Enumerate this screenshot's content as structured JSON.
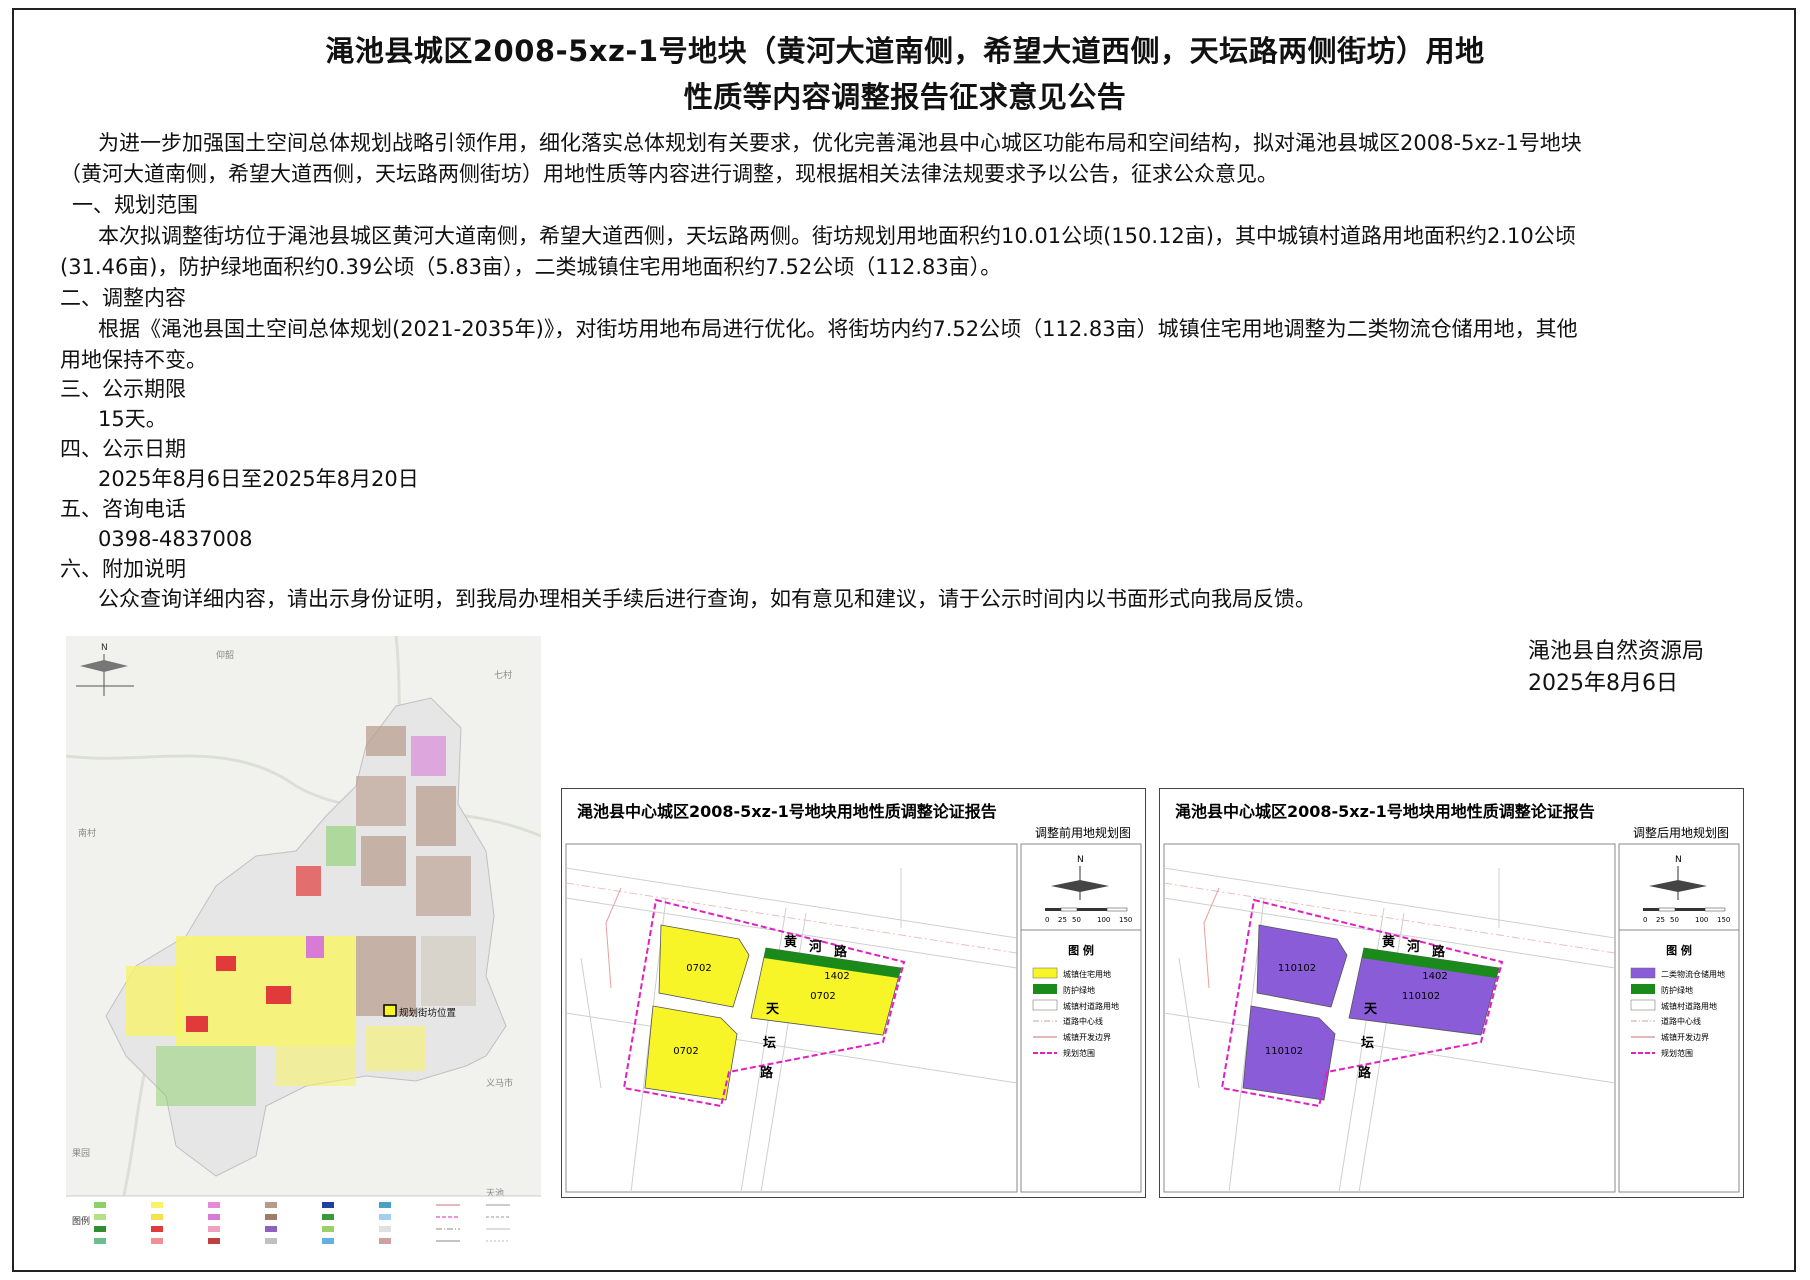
{
  "notice": {
    "title_line1": "渑池县城区2008-5xz-1号地块（黄河大道南侧，希望大道西侧，天坛路两侧街坊）用地",
    "title_line2": "性质等内容调整报告征求意见公告",
    "intro_line1": "为进一步加强国土空间总体规划战略引领作用，细化落实总体规划有关要求，优化完善渑池县中心城区功能布局和空间结构，拟对渑池县城区2008-5xz-1号地块",
    "intro_line2": "（黄河大道南侧，希望大道西侧，天坛路两侧街坊）用地性质等内容进行调整，现根据相关法律法规要求予以公告，征求公众意见。",
    "sections": [
      {
        "heading": "一、规划范围",
        "lines": [
          "本次拟调整街坊位于渑池县城区黄河大道南侧，希望大道西侧，天坛路两侧。街坊规划用地面积约10.01公顷(150.12亩)，其中城镇村道路用地面积约2.10公顷",
          "(31.46亩)，防护绿地面积约0.39公顷（5.83亩），二类城镇住宅用地面积约7.52公顷（112.83亩）。"
        ]
      },
      {
        "heading": "二、调整内容",
        "lines": [
          "根据《渑池县国土空间总体规划(2021-2035年)》，对街坊用地布局进行优化。将街坊内约7.52公顷（112.83亩）城镇住宅用地调整为二类物流仓储用地，其他",
          "用地保持不变。"
        ]
      },
      {
        "heading": "三、公示期限",
        "lines": [
          "15天。"
        ]
      },
      {
        "heading": "四、公示日期",
        "lines": [
          "2025年8月6日至2025年8月20日"
        ]
      },
      {
        "heading": "五、咨询电话",
        "lines": [
          "0398-4837008"
        ]
      },
      {
        "heading": "六、附加说明",
        "lines": [
          "公众查询详细内容，请出示身份证明，到我局办理相关手续后进行查询，如有意见和建议，请于公示时间内以书面形式向我局反馈。"
        ]
      }
    ],
    "signature": {
      "org": "渑池县自然资源局",
      "date": "2025年8月6日"
    }
  },
  "overview_map": {
    "north": "N",
    "site_label": "规划街坊位置",
    "legend_title": "图例",
    "town_labels": [
      "仰韶",
      "七村",
      "南村",
      "义马市",
      "果园",
      "天池"
    ],
    "colors": {
      "residential": "#f7f36a",
      "commercial": "#e03a3a",
      "industrial": "#b89a8a",
      "green": "#8bd06a",
      "public": "#d77bd6",
      "base": "#eeeeee"
    }
  },
  "maps": [
    {
      "title": "渑池县中心城区2008-5xz-1号地块用地性质调整论证报告",
      "subtitle": "调整前用地规划图",
      "parcel_codes": [
        "0702",
        "0702",
        "0702"
      ],
      "parcel_color": "#f7f527",
      "road_code": "1402",
      "road_huanghe": [
        "黄",
        "河",
        "路"
      ],
      "road_tiantan": [
        "天",
        "坛",
        "路"
      ],
      "north": "N",
      "scale": [
        "0",
        "25",
        "50",
        "100",
        "150"
      ],
      "legend_title": "图 例",
      "legend": [
        {
          "label": "城镇住宅用地",
          "color": "#f7f527",
          "style": "fill"
        },
        {
          "label": "防护绿地",
          "color": "#1a8a1a",
          "style": "fill"
        },
        {
          "label": "城镇村道路用地",
          "color": "#ffffff",
          "style": "box"
        },
        {
          "label": "道路中心线",
          "color": "#c8a0a0",
          "style": "dashdot"
        },
        {
          "label": "城镇开发边界",
          "color": "#c87070",
          "style": "line"
        },
        {
          "label": "规划范围",
          "color": "#e020c0",
          "style": "dash"
        }
      ]
    },
    {
      "title": "渑池县中心城区2008-5xz-1号地块用地性质调整论证报告",
      "subtitle": "调整后用地规划图",
      "parcel_codes": [
        "110102",
        "110102",
        "110102"
      ],
      "parcel_color": "#8a5cd8",
      "road_code": "1402",
      "road_huanghe": [
        "黄",
        "河",
        "路"
      ],
      "road_tiantan": [
        "天",
        "坛",
        "路"
      ],
      "north": "N",
      "scale": [
        "0",
        "25",
        "50",
        "100",
        "150"
      ],
      "legend_title": "图 例",
      "legend": [
        {
          "label": "二类物流仓储用地",
          "color": "#8a5cd8",
          "style": "fill"
        },
        {
          "label": "防护绿地",
          "color": "#1a8a1a",
          "style": "fill"
        },
        {
          "label": "城镇村道路用地",
          "color": "#ffffff",
          "style": "box"
        },
        {
          "label": "道路中心线",
          "color": "#c8a0a0",
          "style": "dashdot"
        },
        {
          "label": "城镇开发边界",
          "color": "#c87070",
          "style": "line"
        },
        {
          "label": "规划范围",
          "color": "#e020c0",
          "style": "dash"
        }
      ]
    }
  ]
}
